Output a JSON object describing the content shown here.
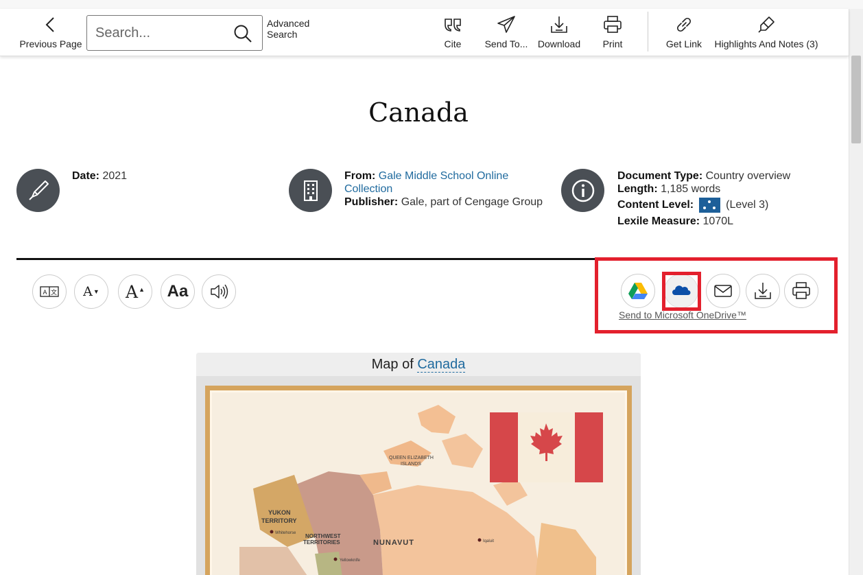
{
  "toolbar": {
    "previous_page": "Previous Page",
    "search_placeholder": "Search...",
    "advanced_search": "Advanced Search",
    "cite": "Cite",
    "send_to": "Send To...",
    "download": "Download",
    "print": "Print",
    "get_link": "Get Link",
    "highlights": "Highlights And Notes (3)"
  },
  "document": {
    "title": "Canada",
    "date_label": "Date:",
    "date_value": "2021",
    "from_label": "From:",
    "from_value": "Gale Middle School Online Collection",
    "publisher_label": "Publisher:",
    "publisher_value": "Gale, part of Cengage Group",
    "doctype_label": "Document Type:",
    "doctype_value": "Country overview",
    "length_label": "Length:",
    "length_value": "1,185 words",
    "content_level_label": "Content Level:",
    "content_level_value": "(Level 3)",
    "lexile_label": "Lexile Measure:",
    "lexile_value": "1070L"
  },
  "tools": {
    "font_decrease": "A",
    "font_increase": "A",
    "font_style": "Aa"
  },
  "share": {
    "tooltip": "Send to Microsoft OneDrive™"
  },
  "map": {
    "caption_prefix": "Map of ",
    "caption_link": "Canada",
    "labels": {
      "queen_elizabeth": "QUEEN ELIZABETH",
      "islands": "ISLANDS",
      "yukon": "YUKON",
      "territory": "TERRITORY",
      "northwest": "NORTHWEST",
      "territories": "TERRITORIES",
      "nunavut": "NUNAVUT",
      "whitehorse": "Whitehorse",
      "yellowknife": "Yellowknife",
      "iqaluit": "Iqaluit"
    }
  },
  "colors": {
    "accent_red": "#e3202d",
    "link_blue": "#1f6a9e",
    "icon_bg": "#4a4f55",
    "level_blue": "#1d5f99"
  }
}
